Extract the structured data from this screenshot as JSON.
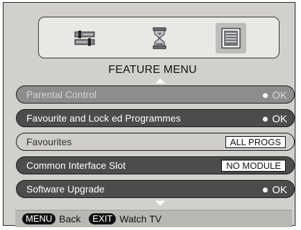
{
  "menu_title": "FEATURE MENU",
  "icons": [
    "settings-sliders-icon",
    "hourglass-icon",
    "feature-menu-icon"
  ],
  "rows": [
    {
      "label": "Parental Control",
      "ok": "OK"
    },
    {
      "label": "Favourite and Lock ed Programmes",
      "ok": "OK"
    },
    {
      "label": "Favourites",
      "value": "ALL PROGS"
    },
    {
      "label": "Common Interface Slot",
      "value": "NO MODULE"
    },
    {
      "label": "Software Upgrade",
      "ok": "OK"
    }
  ],
  "footer": {
    "menu_key": "MENU",
    "menu_label": "Back",
    "exit_key": "EXIT",
    "exit_label": "Watch TV"
  }
}
